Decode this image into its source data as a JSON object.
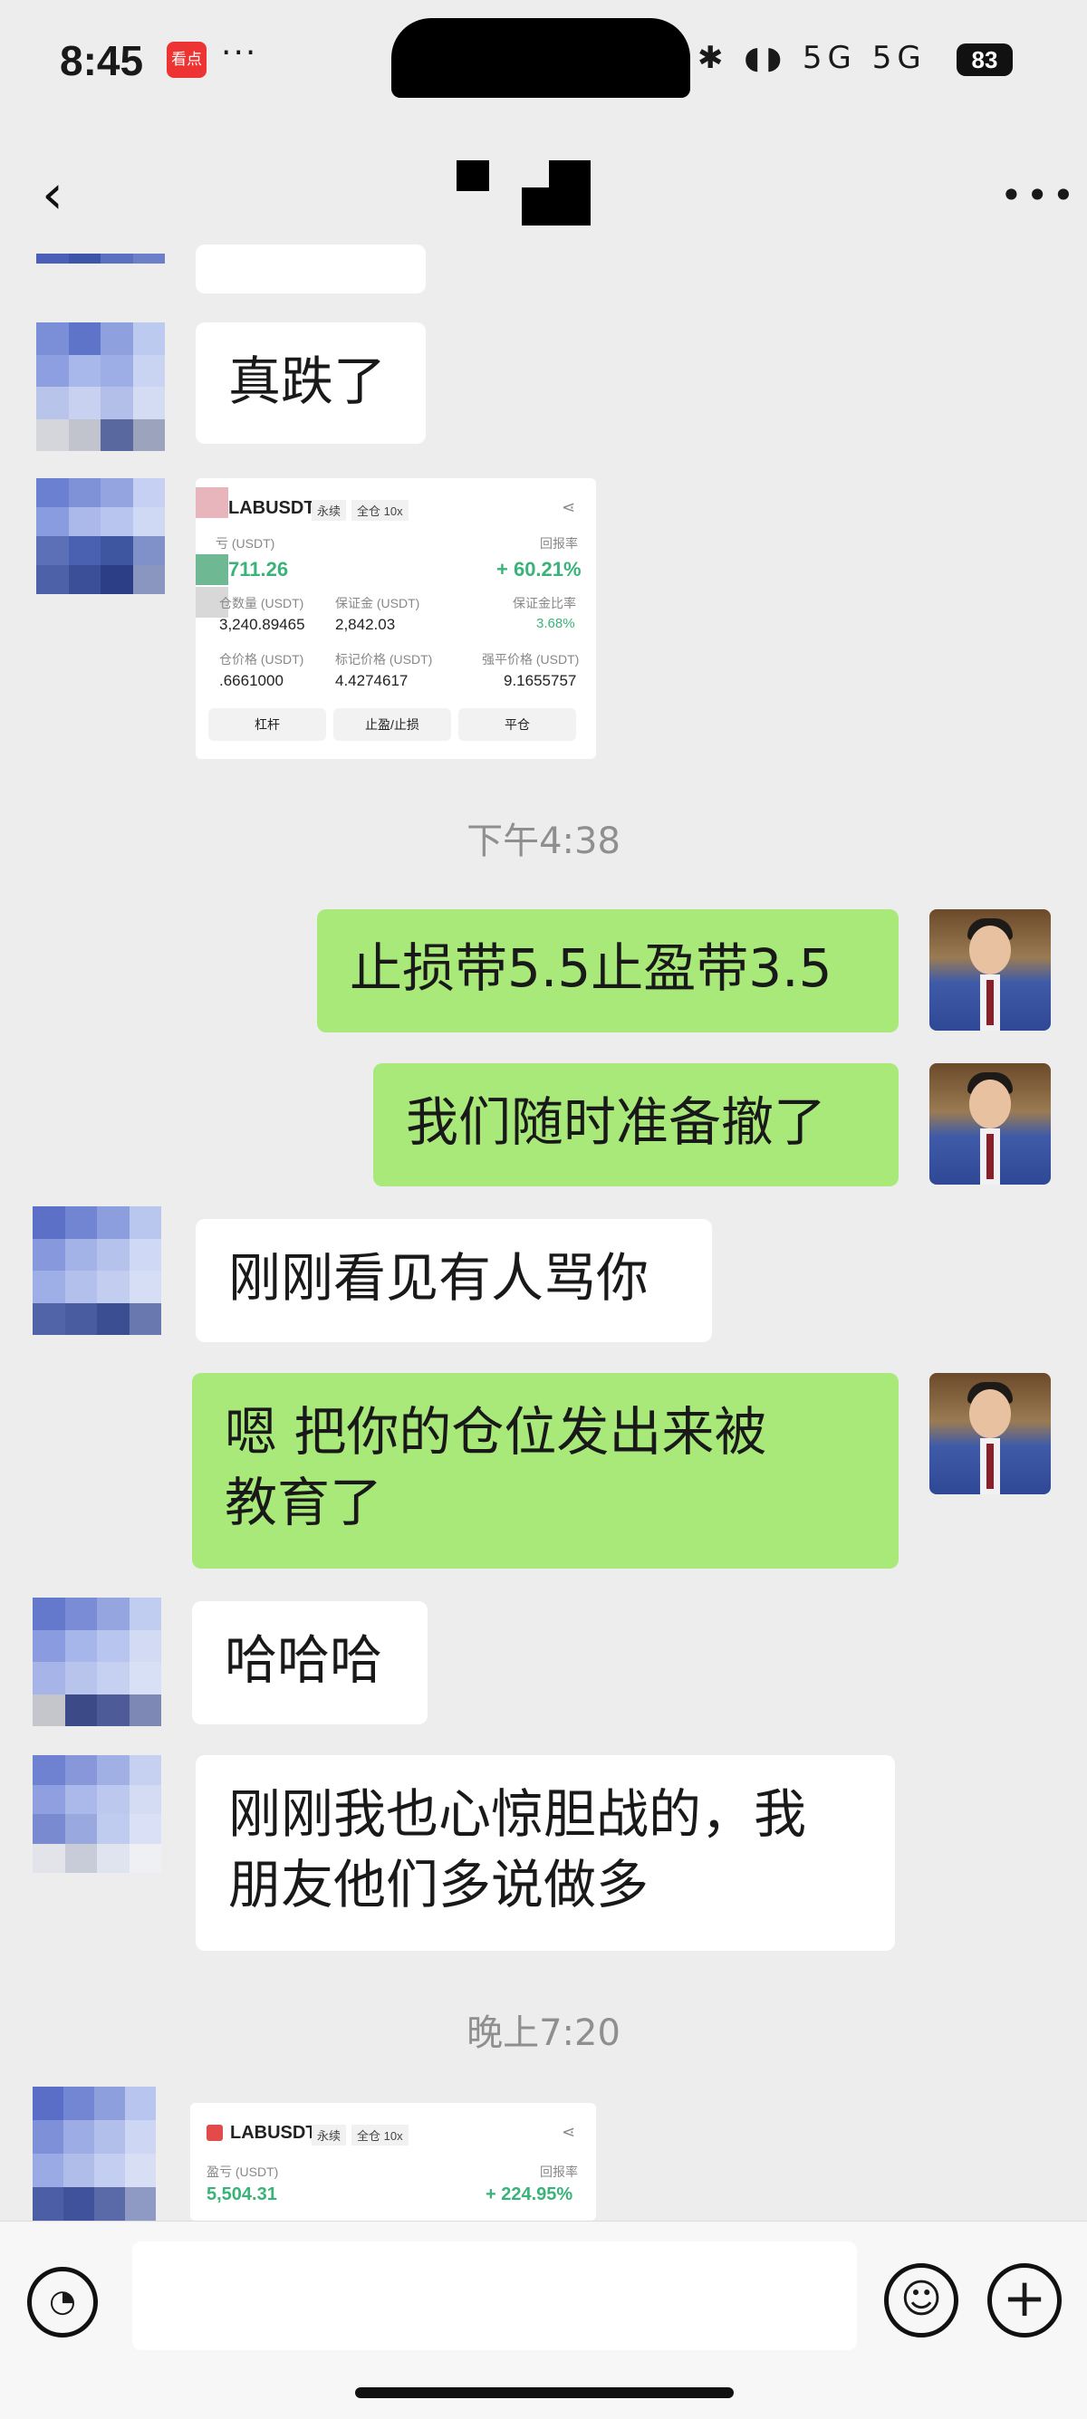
{
  "status_bar": {
    "time": "8:45",
    "app_badge": "看点",
    "more_dots": "···",
    "icons": "✱ ◖◗ 5G 5G",
    "battery": "83"
  },
  "nav": {
    "back_icon": "chevron-left-icon",
    "back_glyph": "‹",
    "more_glyph": "•••"
  },
  "messages": {
    "m1": "真跌了",
    "t1": "下午4:38",
    "m2": "止损带5.5止盈带3.5",
    "m3": "我们随时准备撤了",
    "m4": "刚刚看见有人骂你",
    "m5": "嗯 把你的仓位发出来被\n教育了",
    "m6": "哈哈哈",
    "m7": "刚刚我也心惊胆战的，我\n朋友他们多说做多",
    "t2": "晚上7:20"
  },
  "card1": {
    "symbol": "LABUSDT",
    "tag1": "永续",
    "tag2": "全仓 10x",
    "pnl_label": "亏 (USDT)",
    "pnl_value": "711.26",
    "roe_label": "回报率",
    "roe_value": "+ 60.21%",
    "qty_label": "仓数量 (USDT)",
    "qty_value": "3,240.89465",
    "margin_label": "保证金 (USDT)",
    "margin_value": "2,842.03",
    "ratio_label": "保证金比率",
    "ratio_value": "3.68%",
    "entry_label": "仓价格 (USDT)",
    "entry_value": ".6661000",
    "mark_label": "标记价格 (USDT)",
    "mark_value": "4.4274617",
    "liq_label": "强平价格 (USDT)",
    "liq_value": "9.1655757",
    "btn_leverage": "杠杆",
    "btn_tpsl": "止盈/止损",
    "btn_close": "平仓"
  },
  "card2": {
    "symbol": "LABUSDT",
    "tag1": "永续",
    "tag2": "全仓 10x",
    "pnl_label": "盈亏 (USDT)",
    "pnl_value": "5,504.31",
    "roe_label": "回报率",
    "roe_value": "+ 224.95%"
  },
  "input_bar": {
    "voice_icon": "voice-icon",
    "voice_glyph": "◔",
    "emoji_glyph": "☺",
    "plus_glyph": "+"
  }
}
